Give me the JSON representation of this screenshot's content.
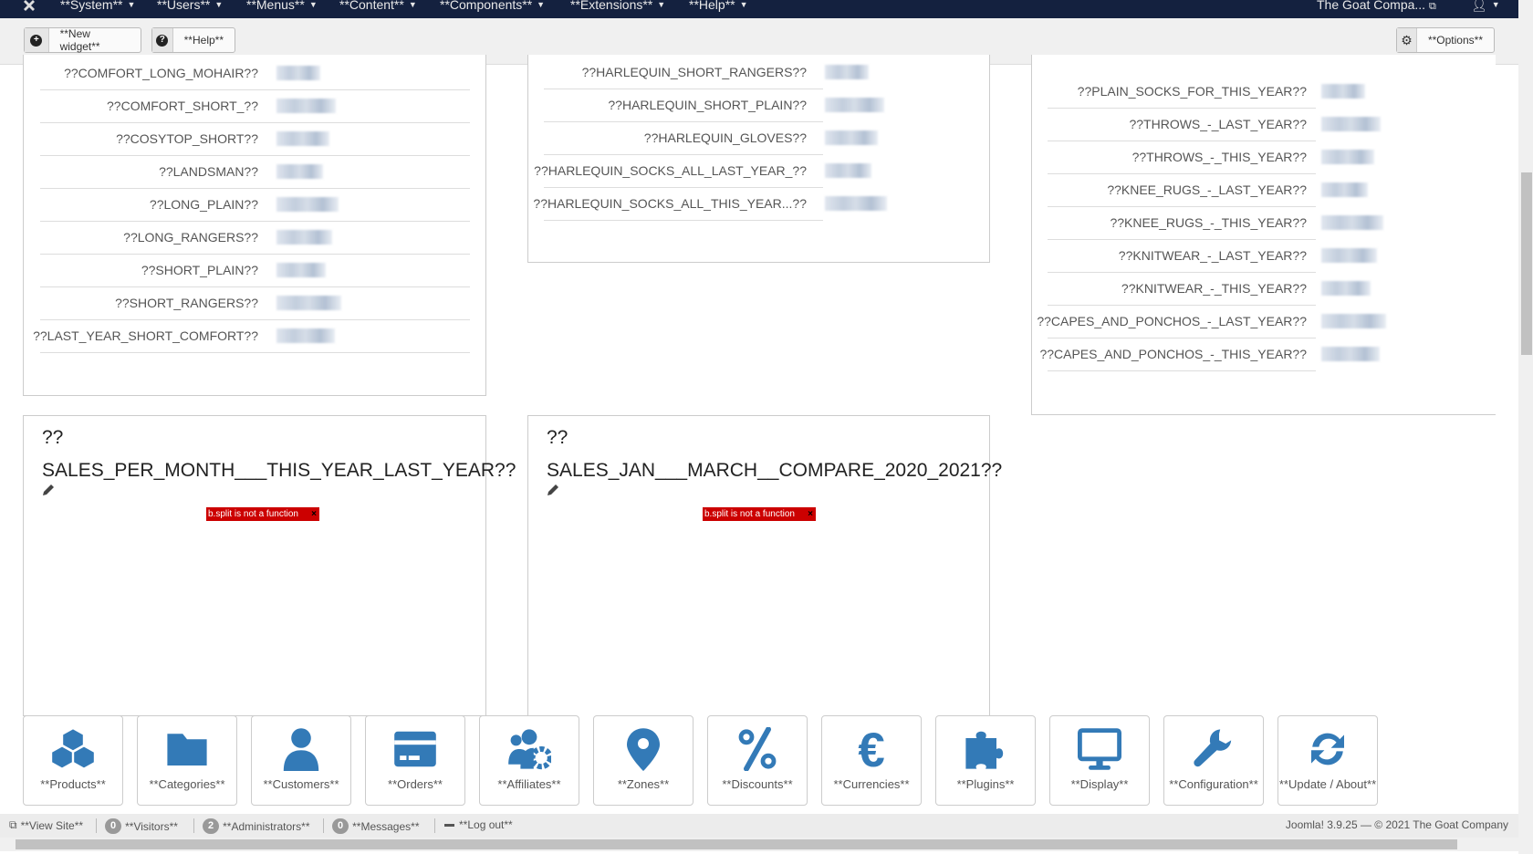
{
  "navbar": {
    "menu": [
      "**System**",
      "**Users**",
      "**Menus**",
      "**Content**",
      "**Components**",
      "**Extensions**",
      "**Help**"
    ],
    "site_name": "The Goat Compa...",
    "bg_color": "#14213f"
  },
  "toolbar": {
    "new_widget": "**New widget**",
    "help": "**Help**",
    "options": "**Options**"
  },
  "widgets": {
    "left_list": [
      "??COMFORT_LONG_MOHAIR??",
      "??COMFORT_SHORT_??",
      "??COSYTOP_SHORT??",
      "??LANDSMAN??",
      "??LONG_PLAIN??",
      "??LONG_RANGERS??",
      "??SHORT_PLAIN??",
      "??SHORT_RANGERS??",
      "??LAST_YEAR_SHORT_COMFORT??"
    ],
    "middle_list": [
      "??HARLEQUIN_SHORT_RANGERS??",
      "??HARLEQUIN_SHORT_PLAIN??",
      "??HARLEQUIN_GLOVES??",
      "??HARLEQUIN_SOCKS_ALL_LAST_YEAR_??",
      "??HARLEQUIN_SOCKS_ALL_THIS_YEAR...??"
    ],
    "right_list": [
      "??PLAIN_SOCKS_FOR_THIS_YEAR??",
      "??THROWS_-_LAST_YEAR??",
      "??THROWS_-_THIS_YEAR??",
      "??KNEE_RUGS_-_LAST_YEAR??",
      "??KNEE_RUGS_-_THIS_YEAR??",
      "??KNITWEAR_-_LAST_YEAR??",
      "??KNITWEAR_-_THIS_YEAR??",
      "??CAPES_AND_PONCHOS_-_LAST_YEAR??",
      "??CAPES_AND_PONCHOS_-_THIS_YEAR??"
    ],
    "chart1": {
      "title_line1": "??",
      "title_line2": "SALES_PER_MONTH___THIS_YEAR_LAST_YEAR??",
      "error": "b.split is not a function",
      "error_close": "×"
    },
    "chart2": {
      "title_line1": "??",
      "title_line2": "SALES_JAN___MARCH__COMPARE_2020_2021??",
      "error": "b.split is not a function",
      "error_close": "×"
    }
  },
  "shortcuts": [
    {
      "label": "**Products**",
      "icon": "cubes-icon"
    },
    {
      "label": "**Categories**",
      "icon": "folder-icon"
    },
    {
      "label": "**Customers**",
      "icon": "user-icon"
    },
    {
      "label": "**Orders**",
      "icon": "credit-card-icon"
    },
    {
      "label": "**Affiliates**",
      "icon": "users-cog-icon"
    },
    {
      "label": "**Zones**",
      "icon": "map-marker-icon"
    },
    {
      "label": "**Discounts**",
      "icon": "percent-icon"
    },
    {
      "label": "**Currencies**",
      "icon": "euro-icon"
    },
    {
      "label": "**Plugins**",
      "icon": "puzzle-icon"
    },
    {
      "label": "**Display**",
      "icon": "monitor-icon"
    },
    {
      "label": "**Configuration**",
      "icon": "wrench-icon"
    },
    {
      "label": "**Update / About**",
      "icon": "refresh-icon"
    }
  ],
  "icon_color": "#337ab7",
  "error_color": "#cc0000",
  "status": {
    "view_site": "**View Site**",
    "visitors_count": "0",
    "visitors": "**Visitors**",
    "admins_count": "2",
    "admins": "**Administrators**",
    "messages_count": "0",
    "messages": "**Messages**",
    "logout": "**Log out**",
    "version": "Joomla! 3.9.25 — © 2021 The Goat Company"
  }
}
